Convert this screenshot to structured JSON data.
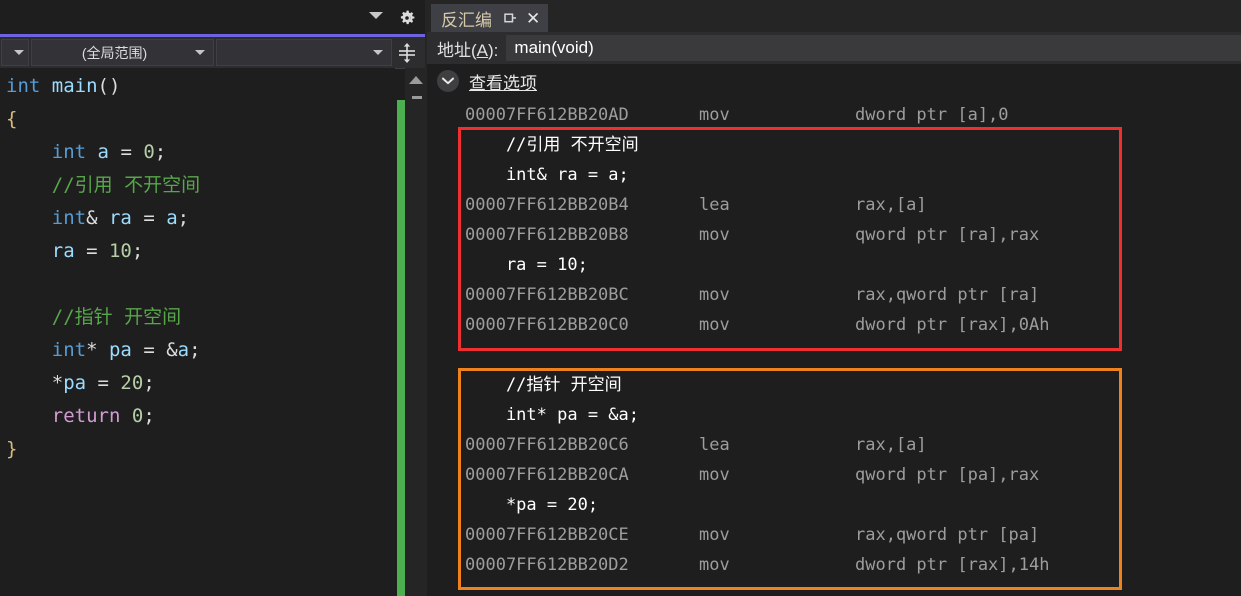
{
  "editor": {
    "toolbar": {
      "chevron_icon": "chevron-down-icon",
      "gear_icon": "gear-icon",
      "split_icon": "split-window-icon"
    },
    "nav": {
      "project_combo": "",
      "scope_combo": "(全局范围)",
      "member_combo": "",
      "caret_icon": "caret-down-icon"
    },
    "code_lines": [
      [
        {
          "t": "int",
          "c": "kw-type"
        },
        {
          "t": " ",
          "c": "plain"
        },
        {
          "t": "main",
          "c": "ident"
        },
        {
          "t": "()",
          "c": "plain"
        }
      ],
      [
        {
          "t": "{",
          "c": "brace"
        }
      ],
      [
        {
          "t": "    ",
          "c": "plain"
        },
        {
          "t": "int",
          "c": "kw-type"
        },
        {
          "t": " ",
          "c": "plain"
        },
        {
          "t": "a",
          "c": "ident"
        },
        {
          "t": " = ",
          "c": "plain"
        },
        {
          "t": "0",
          "c": "num"
        },
        {
          "t": ";",
          "c": "plain"
        }
      ],
      [
        {
          "t": "    ",
          "c": "plain"
        },
        {
          "t": "//引用 不开空间",
          "c": "cmt"
        }
      ],
      [
        {
          "t": "    ",
          "c": "plain"
        },
        {
          "t": "int",
          "c": "kw-type"
        },
        {
          "t": "& ",
          "c": "plain"
        },
        {
          "t": "ra",
          "c": "ident"
        },
        {
          "t": " = ",
          "c": "plain"
        },
        {
          "t": "a",
          "c": "ident"
        },
        {
          "t": ";",
          "c": "plain"
        }
      ],
      [
        {
          "t": "    ",
          "c": "plain"
        },
        {
          "t": "ra",
          "c": "ident"
        },
        {
          "t": " = ",
          "c": "plain"
        },
        {
          "t": "10",
          "c": "num"
        },
        {
          "t": ";",
          "c": "plain"
        }
      ],
      [
        {
          "t": "",
          "c": "plain"
        }
      ],
      [
        {
          "t": "    ",
          "c": "plain"
        },
        {
          "t": "//指针 开空间",
          "c": "cmt"
        }
      ],
      [
        {
          "t": "    ",
          "c": "plain"
        },
        {
          "t": "int",
          "c": "kw-type"
        },
        {
          "t": "* ",
          "c": "plain"
        },
        {
          "t": "pa",
          "c": "ident"
        },
        {
          "t": " = &",
          "c": "plain"
        },
        {
          "t": "a",
          "c": "ident"
        },
        {
          "t": ";",
          "c": "plain"
        }
      ],
      [
        {
          "t": "    *",
          "c": "plain"
        },
        {
          "t": "pa",
          "c": "ident"
        },
        {
          "t": " = ",
          "c": "plain"
        },
        {
          "t": "20",
          "c": "num"
        },
        {
          "t": ";",
          "c": "plain"
        }
      ],
      [
        {
          "t": "    ",
          "c": "plain"
        },
        {
          "t": "return",
          "c": "kw-ctrl"
        },
        {
          "t": " ",
          "c": "plain"
        },
        {
          "t": "0",
          "c": "num"
        },
        {
          "t": ";",
          "c": "plain"
        }
      ],
      [
        {
          "t": "}",
          "c": "brace"
        }
      ]
    ],
    "change_bar_color": "#4caf50",
    "accent_line_color": "#6c63dd",
    "scrollbar": {
      "up_arrow_icon": "scroll-up-arrow-icon",
      "marker_icon": "scroll-marker-icon"
    }
  },
  "disassembly": {
    "tab": {
      "title": "反汇编",
      "pin_icon": "pin-icon",
      "close_icon": "close-icon",
      "close_glyph": "✕"
    },
    "address_bar": {
      "label_prefix": "地址(",
      "label_accesskey": "A",
      "label_suffix": "): ",
      "value": "main(void)",
      "placeholder": "main(void)"
    },
    "view_options": {
      "label": "查看选项",
      "chevron_icon": "chevron-down-icon"
    },
    "lines": [
      {
        "kind": "asm",
        "address": "00007FF612BB20AD",
        "mnemonic": "mov",
        "operands": "dword ptr [a],0"
      },
      {
        "kind": "src",
        "text": "    //引用 不开空间"
      },
      {
        "kind": "src",
        "text": "    int& ra = a;"
      },
      {
        "kind": "asm",
        "address": "00007FF612BB20B4",
        "mnemonic": "lea",
        "operands": "rax,[a]"
      },
      {
        "kind": "asm",
        "address": "00007FF612BB20B8",
        "mnemonic": "mov",
        "operands": "qword ptr [ra],rax"
      },
      {
        "kind": "src",
        "text": "    ra = 10;"
      },
      {
        "kind": "asm",
        "address": "00007FF612BB20BC",
        "mnemonic": "mov",
        "operands": "rax,qword ptr [ra]"
      },
      {
        "kind": "asm",
        "address": "00007FF612BB20C0",
        "mnemonic": "mov",
        "operands": "dword ptr [rax],0Ah"
      },
      {
        "kind": "blank",
        "text": ""
      },
      {
        "kind": "src",
        "text": "    //指针 开空间"
      },
      {
        "kind": "src",
        "text": "    int* pa = &a;"
      },
      {
        "kind": "asm",
        "address": "00007FF612BB20C6",
        "mnemonic": "lea",
        "operands": "rax,[a]"
      },
      {
        "kind": "asm",
        "address": "00007FF612BB20CA",
        "mnemonic": "mov",
        "operands": "qword ptr [pa],rax"
      },
      {
        "kind": "src",
        "text": "    *pa = 20;"
      },
      {
        "kind": "asm",
        "address": "00007FF612BB20CE",
        "mnemonic": "mov",
        "operands": "rax,qword ptr [pa]"
      },
      {
        "kind": "asm",
        "address": "00007FF612BB20D2",
        "mnemonic": "mov",
        "operands": "dword ptr [rax],14h"
      }
    ],
    "annotations": [
      {
        "name": "reference-highlight-box",
        "color": "#f03030"
      },
      {
        "name": "pointer-highlight-box",
        "color": "#f0821e"
      }
    ]
  }
}
